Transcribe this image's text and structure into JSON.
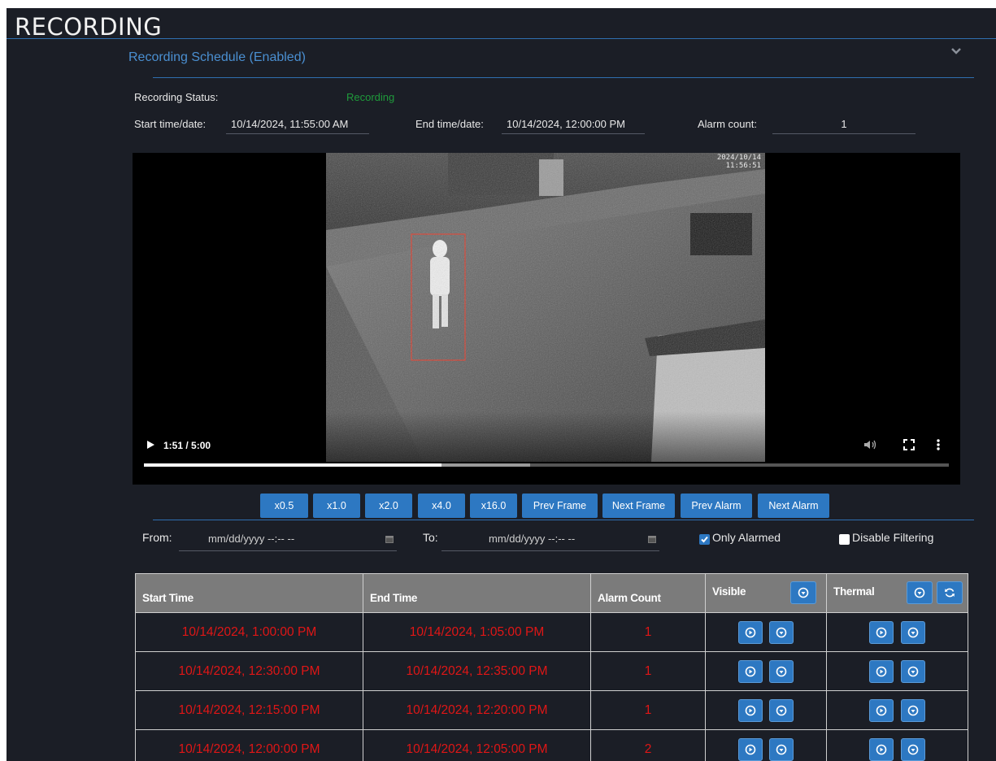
{
  "header": {
    "title": "RECORDING"
  },
  "schedule": {
    "title": "Recording Schedule (Enabled)"
  },
  "status": {
    "label": "Recording Status:",
    "value": "Recording",
    "value_color": "#1f9a3b",
    "start_label": "Start time/date:",
    "start_value": "10/14/2024, 11:55:00 AM",
    "end_label": "End time/date:",
    "end_value": "10/14/2024, 12:00:00 PM",
    "alarm_label": "Alarm count:",
    "alarm_value": "1"
  },
  "video": {
    "time": "1:51 / 5:00",
    "timestamp_overlay": "2024/10/14 11:56:51",
    "progress_fraction": 0.37,
    "buffered_fraction": 0.48
  },
  "playback": {
    "speeds": [
      "x0.5",
      "x1.0",
      "x2.0",
      "x4.0",
      "x16.0"
    ],
    "prev_frame": "Prev Frame",
    "next_frame": "Next Frame",
    "prev_alarm": "Prev Alarm",
    "next_alarm": "Next Alarm"
  },
  "filters": {
    "from_label": "From:",
    "from_placeholder": "mm/dd/yyyy --:-- --",
    "to_label": "To:",
    "to_placeholder": "mm/dd/yyyy --:-- --",
    "only_alarmed_label": "Only Alarmed",
    "only_alarmed_checked": true,
    "disable_filtering_label": "Disable Filtering",
    "disable_filtering_checked": false
  },
  "table": {
    "headers": {
      "start": "Start Time",
      "end": "End Time",
      "alarm": "Alarm Count",
      "visible": "Visible",
      "thermal": "Thermal"
    },
    "row_color": "#e01616",
    "rows": [
      {
        "start": "10/14/2024, 1:00:00 PM",
        "end": "10/14/2024, 1:05:00 PM",
        "alarm": "1"
      },
      {
        "start": "10/14/2024, 12:30:00 PM",
        "end": "10/14/2024, 12:35:00 PM",
        "alarm": "1"
      },
      {
        "start": "10/14/2024, 12:15:00 PM",
        "end": "10/14/2024, 12:20:00 PM",
        "alarm": "1"
      },
      {
        "start": "10/14/2024, 12:00:00 PM",
        "end": "10/14/2024, 12:05:00 PM",
        "alarm": "2"
      }
    ]
  },
  "colors": {
    "background": "#1b1e26",
    "accent": "#2d78c2",
    "header_link": "#4a8fd1",
    "table_header": "#7b7b7b"
  },
  "icons": [
    "chevron-down-icon",
    "play-icon",
    "mute-icon",
    "fullscreen-icon",
    "more-vert-icon",
    "play-circle-icon",
    "download-icon",
    "refresh-icon",
    "calendar-icon"
  ]
}
